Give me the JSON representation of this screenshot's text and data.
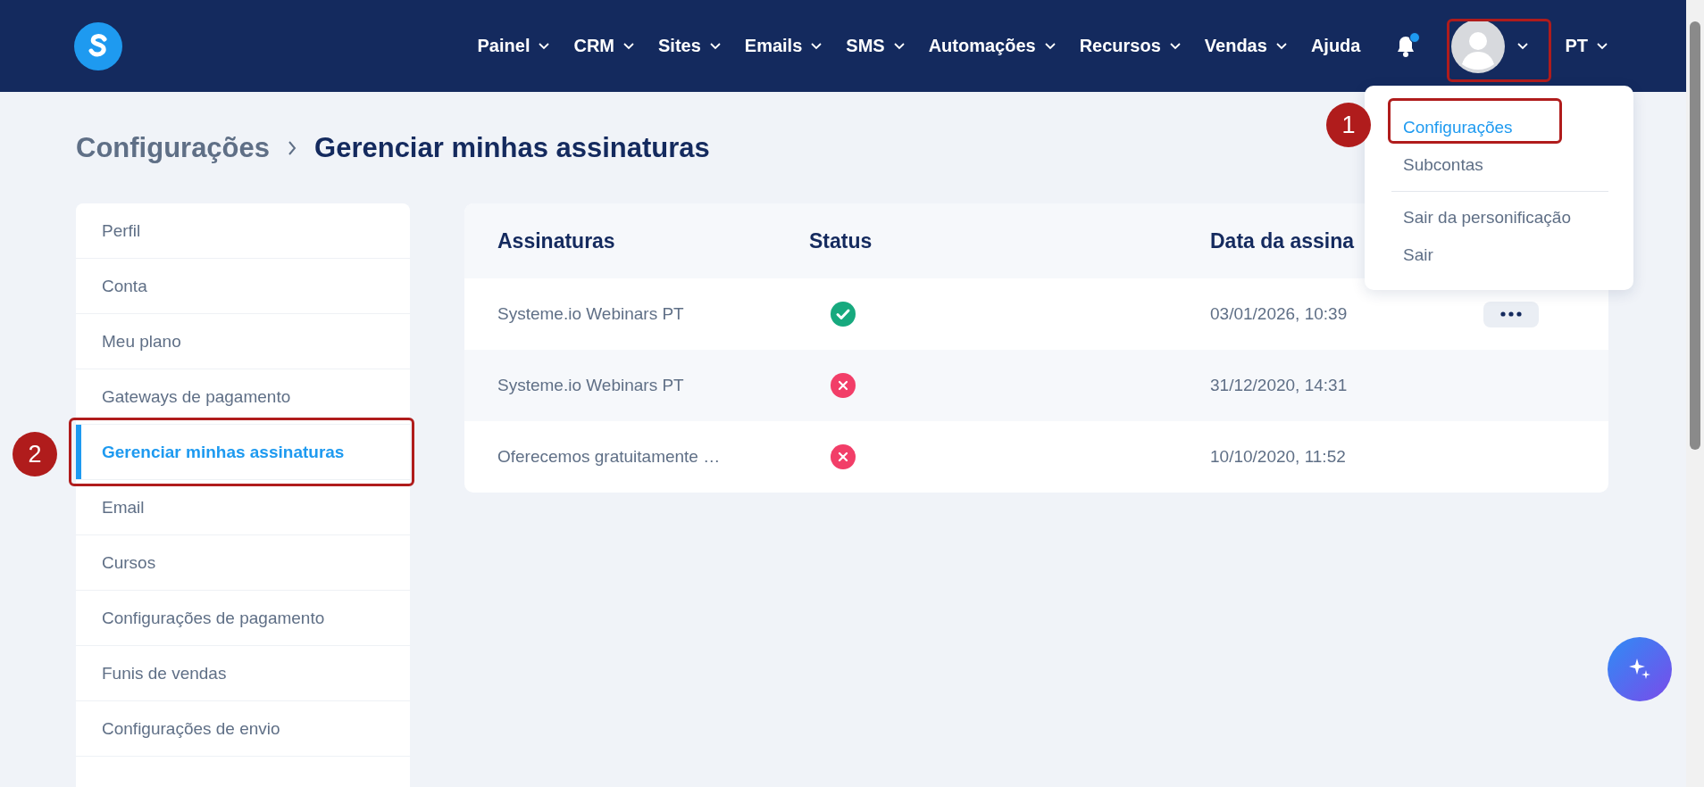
{
  "nav": {
    "items": [
      {
        "label": "Painel",
        "has_menu": true
      },
      {
        "label": "CRM",
        "has_menu": true
      },
      {
        "label": "Sites",
        "has_menu": true
      },
      {
        "label": "Emails",
        "has_menu": true
      },
      {
        "label": "SMS",
        "has_menu": true
      },
      {
        "label": "Automações",
        "has_menu": true
      },
      {
        "label": "Recursos",
        "has_menu": true
      },
      {
        "label": "Vendas",
        "has_menu": true
      },
      {
        "label": "Ajuda",
        "has_menu": false
      }
    ],
    "notification": true,
    "language": "PT"
  },
  "breadcrumb": [
    "Configurações",
    "Gerenciar minhas assinaturas"
  ],
  "sidebar": {
    "items": [
      {
        "label": "Perfil",
        "selected": false
      },
      {
        "label": "Conta",
        "selected": false
      },
      {
        "label": "Meu plano",
        "selected": false
      },
      {
        "label": "Gateways de pagamento",
        "selected": false
      },
      {
        "label": "Gerenciar minhas assinaturas",
        "selected": true
      },
      {
        "label": "Email",
        "selected": false
      },
      {
        "label": "Cursos",
        "selected": false
      },
      {
        "label": "Configurações de pagamento",
        "selected": false
      },
      {
        "label": "Funis de vendas",
        "selected": false
      },
      {
        "label": "Configurações de envio",
        "selected": false
      }
    ]
  },
  "table": {
    "columns": [
      "Assinaturas",
      "Status",
      "Data da assina"
    ],
    "rows": [
      {
        "name": "Systeme.io Webinars PT",
        "active": true,
        "date": "03/01/2026, 10:39",
        "actions": true
      },
      {
        "name": "Systeme.io Webinars PT",
        "active": false,
        "date": "31/12/2020, 14:31",
        "actions": false
      },
      {
        "name": "Oferecemos gratuitamente …",
        "active": false,
        "date": "10/10/2020, 11:52",
        "actions": false
      }
    ]
  },
  "user_menu": {
    "items": [
      {
        "label": "Configurações",
        "selected": true,
        "divider_after": false
      },
      {
        "label": "Subcontas",
        "selected": false,
        "divider_after": true
      },
      {
        "label": "Sair da personificação",
        "selected": false,
        "divider_after": false
      },
      {
        "label": "Sair",
        "selected": false,
        "divider_after": false
      }
    ]
  },
  "annotations": [
    "1",
    "2"
  ]
}
